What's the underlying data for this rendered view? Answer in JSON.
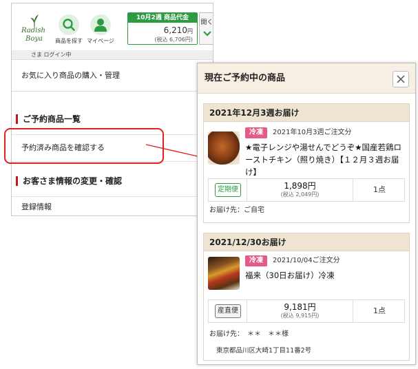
{
  "header": {
    "logo_line1": "Radish",
    "logo_line2": "Boya",
    "search_label": "商品を探す",
    "mypage_label": "マイページ",
    "cart": {
      "title": "10月2週 商品代金",
      "amount": "6,210",
      "amount_unit": "円",
      "tax_note": "(税込 6,706円)"
    },
    "open_label": "開く"
  },
  "login_status": "さま ログイン中",
  "menu": {
    "favorites": "お気に入り商品の購入・管理",
    "section_reservations": "ご予約商品一覧",
    "reserved_link": "予約済み商品を確認する",
    "section_customer": "お客さま情報の変更・確認",
    "registration": "登録情報"
  },
  "modal": {
    "title": "現在ご予約中の商品",
    "reservations": [
      {
        "delivery_heading": "2021年12月3週お届け",
        "tag": "冷凍",
        "order_date": "2021年10月3週ご注文分",
        "product_name": "★電子レンジや湯せんでどうぞ★国産若鶏ローストチキン（照り焼き）【１２月３週お届け】",
        "badge": "定期便",
        "price": "1,898円",
        "price_tax": "(税込 2,049円)",
        "quantity": "1点",
        "destination": "お届け先：ご自宅",
        "address": ""
      },
      {
        "delivery_heading": "2021/12/30お届け",
        "tag": "冷凍",
        "order_date": "2021/10/04ご注文分",
        "product_name": "福来（30日お届け）冷凍",
        "badge": "産直便",
        "price": "9,181円",
        "price_tax": "(税込 9,915円)",
        "quantity": "1点",
        "destination": "お届け先：　＊＊　＊＊様",
        "address": "東京都品川区大崎1丁目11番2号"
      }
    ]
  },
  "colors": {
    "brand_green": "#2e9b43",
    "accent_red": "#c0181d",
    "highlight_red": "#e0201d",
    "frozen_tag": "#e25c86",
    "modal_header": "#f7efe3",
    "card_header": "#efe4d2"
  },
  "icons": {
    "search": "search-icon",
    "mypage": "user-icon",
    "open": "chevron-down-icon",
    "close": "close-icon"
  }
}
